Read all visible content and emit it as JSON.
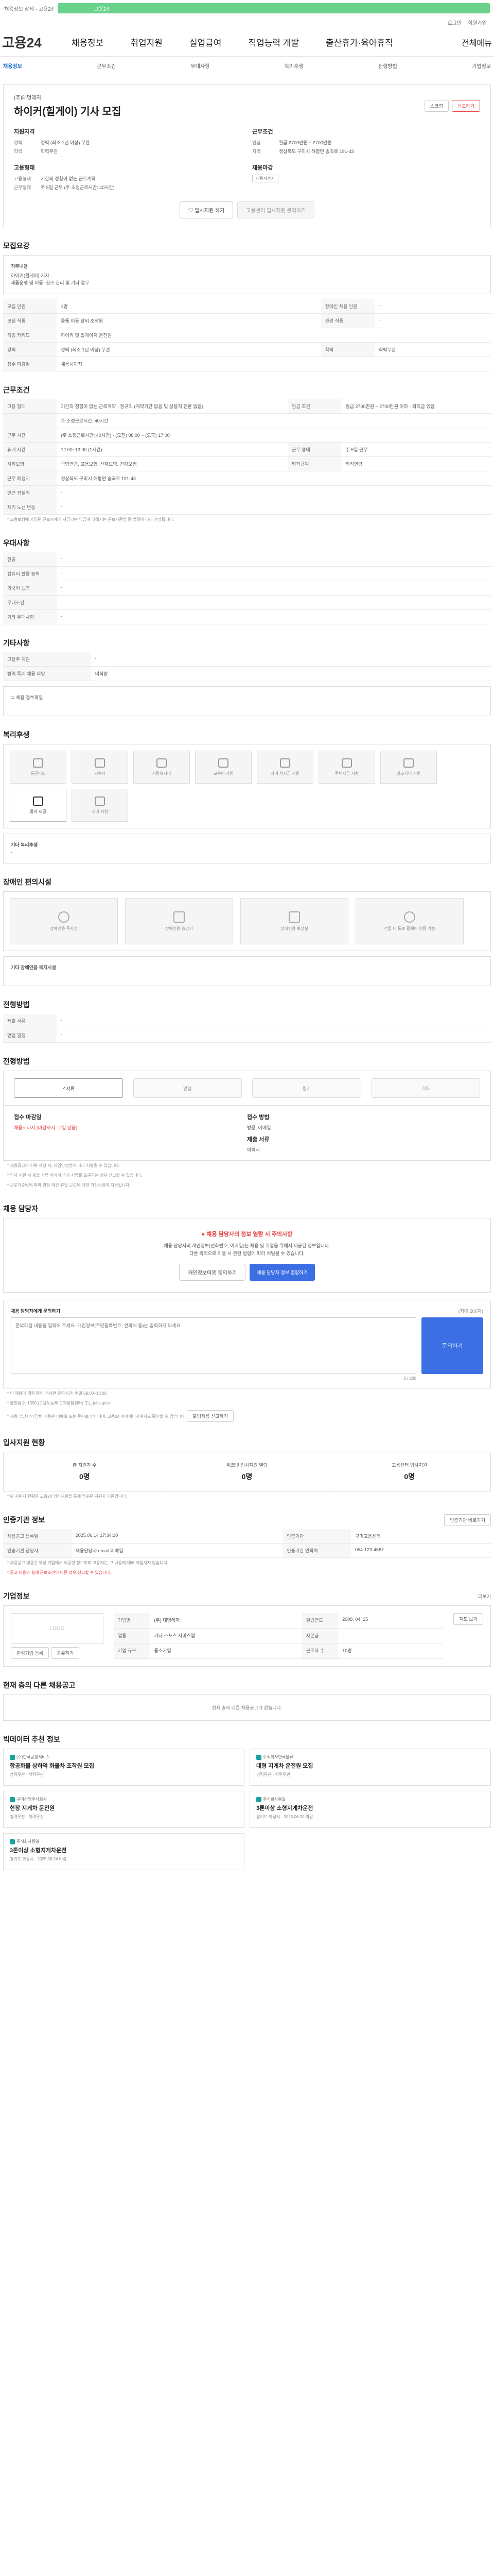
{
  "topbar": {
    "left": "채용정보 상세 - 고용24",
    "search": "고용24"
  },
  "util": {
    "login": "로그인",
    "join": "회원가입"
  },
  "gnb": {
    "logo": "고용24",
    "menu": [
      "채용정보",
      "취업지원",
      "실업급여",
      "직업능력 개발",
      "출산휴가·육아휴직"
    ],
    "right": "전체메뉴"
  },
  "tabs": [
    "채용정보",
    "근무조건",
    "우대사항",
    "복리후생",
    "전형방법",
    "기업정보"
  ],
  "head": {
    "company": "(주)대명레저",
    "title": "하이커(힐게이) 기사 모집",
    "scrap": "스크랩",
    "report": "신고하기",
    "g1_title": "지원자격",
    "g1": [
      {
        "k": "경력",
        "v": "경력 (최소 1년 이상) 무관"
      },
      {
        "k": "학력",
        "v": "학력무관"
      }
    ],
    "g2_title": "근무조건",
    "g2": [
      {
        "k": "임금",
        "v": "월급 2700만원 ~ 2700만원"
      },
      {
        "k": "지역",
        "v": "경상북도 구미시 해평면 송곡로 191-43"
      }
    ],
    "g3_title": "고용형태",
    "g3": [
      {
        "k": "고용형태",
        "v": "기간의 정함이 없는 근로계약"
      },
      {
        "k": "근무형태",
        "v": "주 5일 근무 (주 소정근로시간: 40시간)"
      }
    ],
    "g4_title": "채용마감",
    "g4_tag": "채용시까지",
    "btn_apply": "입사지원 하기",
    "btn_consult": "고용센터 입사지원 문의하기"
  },
  "recruit": {
    "title": "모집요강",
    "desc_title": "직무내용",
    "desc_lines": [
      "하이커(힐게이) 기사",
      "제품운행 및 이동, 청소 관리 및 기타 업무"
    ],
    "rows": [
      [
        {
          "k": "모집 인원",
          "v": "1명"
        },
        {
          "k": "장애인 채용 인원",
          "v": "-"
        }
      ],
      [
        {
          "k": "모집 직종",
          "v": "물품 이동 장비 조작원"
        },
        {
          "k": "관련 직종",
          "v": "-"
        }
      ],
      [
        {
          "k": "직종 키워드",
          "v": "하이커 및 휠게이지 운전원"
        },
        {
          "k": "",
          "v": ""
        }
      ],
      [
        {
          "k": "경력",
          "v": "경력 (최소 1년 이상) 무관"
        },
        {
          "k": "학력",
          "v": "학력무관"
        }
      ],
      [
        {
          "k": "접수 마감일",
          "v": "채용시까지"
        },
        {
          "k": "",
          "v": ""
        }
      ]
    ]
  },
  "conditions": {
    "title": "근무조건",
    "rows": [
      [
        {
          "k": "고용 형태",
          "v": "기간의 정함이 없는 근로계약 · 정규직 (계약기간 없음 및 상용직 전환 없음)"
        },
        {
          "k": "임금 조건",
          "v": "월급 2700만원 ~ 2700만원 이하 · 퇴직금 있음"
        }
      ],
      [
        {
          "k": "",
          "v": "주 소정근로시간: 40시간"
        },
        {
          "k": "",
          "v": ""
        }
      ],
      [
        {
          "k": "근무 시간",
          "v": "(주 소정근로시간: 40시간) · (오전) 08:00 ~ (오후) 17:00"
        },
        {
          "k": "",
          "v": ""
        }
      ],
      [
        {
          "k": "휴게 시간",
          "v": "12:00~13:00 (1시간)"
        },
        {
          "k": "근무 형태",
          "v": "주 5일 근무"
        }
      ],
      [
        {
          "k": "사회보험",
          "v": "국민연금, 고용보험, 산재보험, 건강보험"
        },
        {
          "k": "퇴직급여",
          "v": "퇴직연금"
        }
      ],
      [
        {
          "k": "근무 예정지",
          "v": "경상북도 구미시 해평면 송곡로 191-43"
        },
        {
          "k": "",
          "v": ""
        }
      ],
      [
        {
          "k": "인근 전철역",
          "v": "-"
        },
        {
          "k": "",
          "v": ""
        }
      ],
      [
        {
          "k": "재기 노선 변동",
          "v": "-"
        },
        {
          "k": "",
          "v": ""
        }
      ]
    ],
    "note": "* 고용보험에 가입된 근로자에게 지급되는 임금에 대해서는 근로기준법 등 법령에 따라 산정됩니다."
  },
  "preference": {
    "title": "우대사항",
    "rows": [
      {
        "k": "전공",
        "v": "-"
      },
      {
        "k": "컴퓨터 활용 능력",
        "v": "-"
      },
      {
        "k": "외국어 능력",
        "v": "-"
      },
      {
        "k": "우대조건",
        "v": "-"
      },
      {
        "k": "기타 우대사항",
        "v": "-"
      }
    ]
  },
  "other": {
    "title": "기타사항",
    "rows": [
      {
        "k": "고용주 지원",
        "v": "-"
      },
      {
        "k": "병역 특례 채용 희망",
        "v": "비희망"
      }
    ],
    "files_label": "채용 첨부파일",
    "files_value": "-"
  },
  "welfare": {
    "title": "복리후생",
    "items": [
      "통근버스",
      "기숙사",
      "차량유지비",
      "교육비 지원",
      "자녀 학자금 지원",
      "주택자금 지원",
      "경조사비 지원",
      "중식 제공",
      "식대 지원"
    ],
    "active": [
      "중식 제공"
    ],
    "etc_label": "기타 복리후생",
    "etc_value": "-"
  },
  "disability": {
    "title": "장애인 편의시설",
    "items": [
      "장애인용 주차장",
      "장애인용 승강기",
      "장애인용 화장실",
      "건물 내 통로 휠체어 이동 가능"
    ],
    "etc_label": "기타 장애인용 복지시설",
    "etc_value": "-"
  },
  "method": {
    "title": "전형방법",
    "rows": [
      {
        "k": "제출 서류",
        "v": "-"
      },
      {
        "k": "면접 일정",
        "v": "-"
      }
    ]
  },
  "process": {
    "title": "전형방법",
    "steps": [
      "서류",
      "면접",
      "필기",
      "기타"
    ],
    "active": [
      "서류"
    ],
    "left_label": "접수 마감일",
    "left_value": "채용시까지 (마감까지 - 2일 남음)",
    "right_label": "접수 방법",
    "right_value": "방문, 이메일",
    "right_label2": "제출 서류",
    "right_value2": "이력서",
    "notes": [
      "* 채용공고의 허위 작성 시, 직업안정법에 따라 처벌될 수 있습니다.",
      "* 입사 지원 시 제출 서류 이외의 추가 서류를 요구하는 경우 신고할 수 있습니다.",
      "* 근로기준법에 따라 연장·야간·휴일 근로에 대한 가산수당이 지급됩니다."
    ]
  },
  "contact": {
    "title": "채용 담당자",
    "alert": "채용 담당자의 정보 열람 시 주의사항",
    "alert_lines": [
      "채용 담당자의 개인정보(전화번호, 이메일)는 채용 및 취업을 위해서 제공된 정보입니다.",
      "다른 목적으로 이용 시 관련 법령에 따라 처벌될 수 있습니다."
    ],
    "btn_agree": "개인정보이용 동의하기",
    "btn_view": "채용 담당자 정보 열람하기",
    "inquiry_title": "채용 담당자에게 문의하기",
    "inquiry_hint": "(최대 200자)",
    "inquiry_placeholder": "문의하실 내용을 입력해 주세요. 개인정보(주민등록번호, 연락처 등)는 입력하지 마세요.",
    "inquiry_count": "0 / 200",
    "inquiry_btn": "문의하기",
    "notes": [
      "* 이 채용에 대한 문의 게시판 운영시간: 평일 09:00~18:00",
      "* 불만접수: 1350 (고용노동부 고객상담센터) 또는 jobs.go.kr",
      "* 채용 담당자의 답변 내용은 이메일 또는 문자로 안내되며, 고용24 마이페이지에서도 확인할 수 있습니다."
    ],
    "note_btn": "불법채용 신고하기"
  },
  "stats": {
    "title": "입사지원 현황",
    "items": [
      {
        "label": "총 지원자 수",
        "value": "0명"
      },
      {
        "label": "워크넷 입사지원 열람",
        "value": "0명"
      },
      {
        "label": "고용센터 입사지원",
        "value": "0명"
      }
    ],
    "note": "* 위 지원자 현황은 고용24 입사지원을 통해 접수된 지원자 기준입니다."
  },
  "agency": {
    "title": "인증기관 정보",
    "btn": "인증기관 바로가기",
    "rows": [
      [
        {
          "k": "채용공고 등록일",
          "v": "2025.06.14 17:34:10"
        },
        {
          "k": "인증기관",
          "v": "구미고용센터"
        }
      ],
      [
        {
          "k": "인증기관 담당자",
          "v": "채용담당자 email 이메일"
        },
        {
          "k": "인증기관 연락처",
          "v": "054-123-4567"
        }
      ]
    ],
    "notes": [
      "* 채용공고 내용은 작성 기업에서 제공한 정보이며 고용24는 그 내용에 대해 책임지지 않습니다.",
      "* 공고 내용과 실제 근로조건이 다른 경우 신고할 수 있습니다."
    ]
  },
  "company": {
    "title": "기업정보",
    "more": "더보기",
    "logo_label": "LOGO",
    "btn1": "관심기업 등록",
    "btn2": "공유하기",
    "rows": [
      [
        {
          "k": "기업명",
          "v": "(주) 대명레저"
        },
        {
          "k": "설립연도",
          "v": "2008. 04. 25"
        }
      ],
      [
        {
          "k": "업종",
          "v": "기타 스포츠 서비스업"
        },
        {
          "k": "자본금",
          "v": "-"
        }
      ],
      [
        {
          "k": "기업 규모",
          "v": "중소기업"
        },
        {
          "k": "근로자 수",
          "v": "10명"
        }
      ]
    ],
    "btn_map": "지도 보기"
  },
  "similar": {
    "title": "현재 층의 다른 채용공고",
    "empty": "현재 층의 다른 채용공고가 없습니다."
  },
  "recommend": {
    "title": "빅데이터 추천 정보",
    "cards": [
      {
        "company": "(주)한국공항서비스",
        "title": "항공화물 상하역 화물차 조작원 모집",
        "meta": "경력무관 · 학력무관"
      },
      {
        "company": "주식회사한국물류",
        "title": "대형 지게차 운전원 모집",
        "meta": "경력무관 · 학력무관"
      },
      {
        "company": "구미산업주식회사",
        "title": "현장 지게차 운전원",
        "meta": "경력무관 · 학력무관"
      },
      {
        "company": "주식회사동일",
        "title": "3톤이상 소형지게차운전",
        "meta": "경기도 화성시 · 2025.06.20 마감"
      },
      {
        "company": "주식회사동일",
        "title": "3톤이상 소형지게차운전",
        "meta": "경기도 화성시 · 2025.06.24 마감"
      }
    ]
  }
}
